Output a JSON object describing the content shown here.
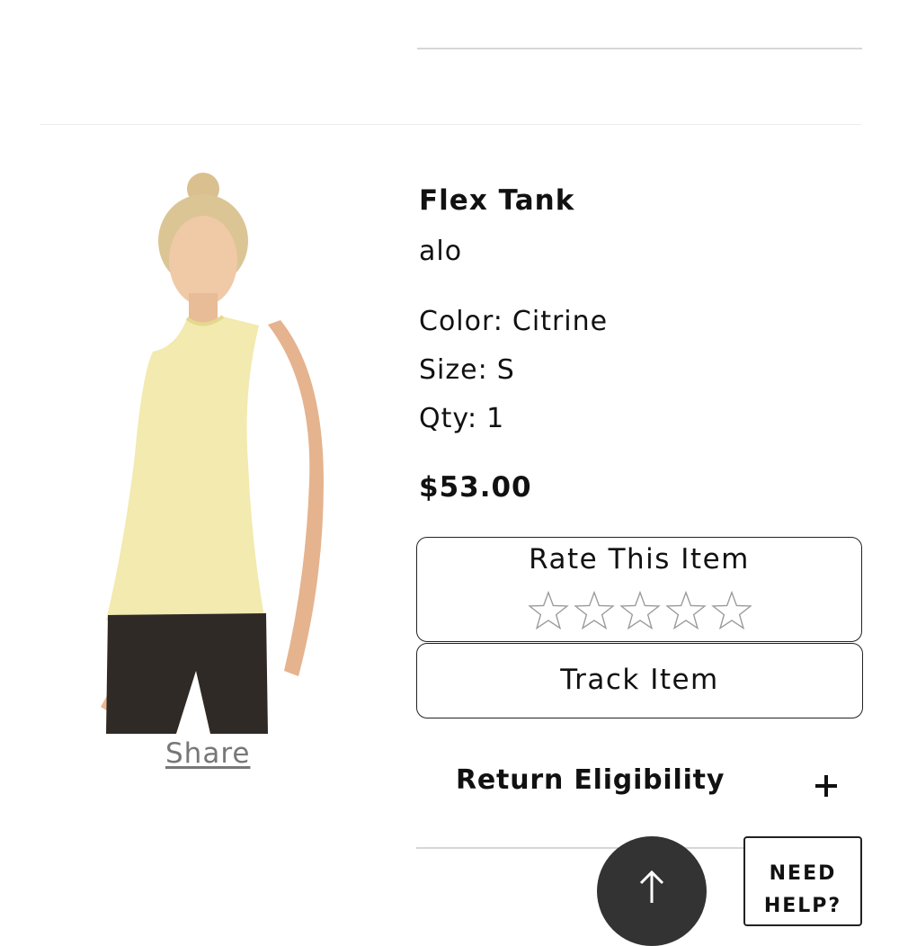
{
  "product": {
    "title": "Flex Tank",
    "brand": "alo",
    "attributes": [
      {
        "label": "Color:",
        "value": "Citrine"
      },
      {
        "label": "Size:",
        "value": "S"
      },
      {
        "label": "Qty:",
        "value": "1"
      }
    ],
    "price": "$53.00",
    "image_icon": "product-photo"
  },
  "share": {
    "label": "Share"
  },
  "rating": {
    "label": "Rate This Item",
    "max_stars": 5,
    "current": 0
  },
  "track": {
    "label": "Track Item"
  },
  "return_eligibility": {
    "label": "Return Eligibility",
    "icon": "plus-icon"
  },
  "scroll_top": {
    "icon": "arrow-up-icon"
  },
  "need_help": {
    "label": "NEED HELP?"
  },
  "colors": {
    "accent_dark": "#333333",
    "rule": "#d6d6d6",
    "muted_text": "#777777",
    "garment": "#f2eaae"
  }
}
